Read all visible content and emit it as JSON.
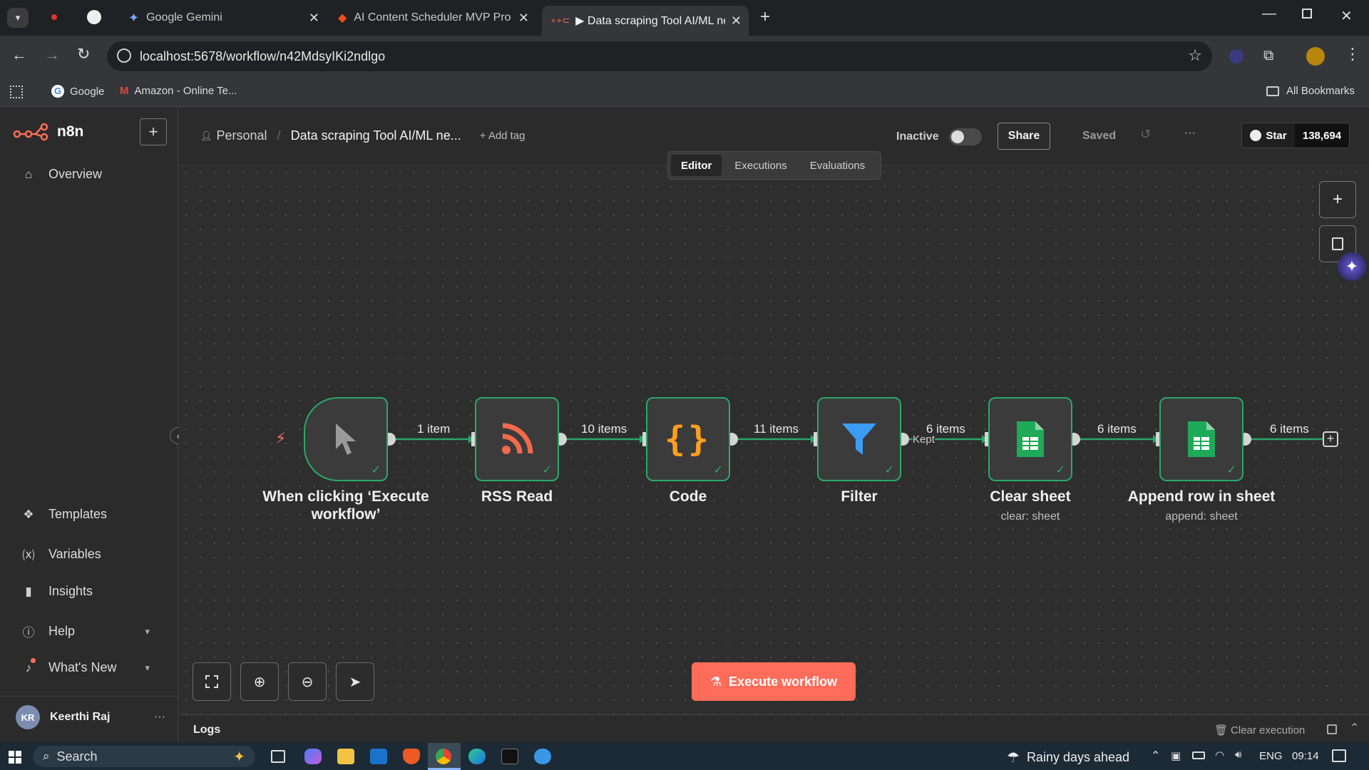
{
  "browser": {
    "tabs": [
      {
        "title": "Google Gemini"
      },
      {
        "title": "AI Content Scheduler MVP Prot"
      },
      {
        "title": "▶ Data scraping Tool AI/ML ne"
      }
    ],
    "url": "localhost:5678/workflow/n42MdsyIKi2ndlgo",
    "bookmarks": {
      "google": "Google",
      "amazon": "Amazon - Online Te...",
      "all": "All Bookmarks"
    }
  },
  "app": {
    "brand": "n8n",
    "sidebar": {
      "overview": "Overview",
      "bottom_items": [
        "Templates",
        "Variables",
        "Insights",
        "Help",
        "What's New"
      ],
      "user_initials": "KR",
      "user_name": "Keerthi Raj",
      "more": "···"
    },
    "header": {
      "project": "Personal",
      "workflow_name": "Data scraping Tool AI/ML ne...",
      "add_tag": "+ Add tag",
      "status_label": "Inactive",
      "share_label": "Share",
      "saved_label": "Saved",
      "more": "···",
      "github_star_label": "Star",
      "github_star_count": "138,694"
    },
    "view_tabs": [
      "Editor",
      "Executions",
      "Evaluations"
    ],
    "active_view_tab": "Editor"
  },
  "workflow": {
    "nodes": [
      {
        "label": "When clicking ‘Execute workflow’",
        "sub": ""
      },
      {
        "label": "RSS Read",
        "sub": ""
      },
      {
        "label": "Code",
        "sub": ""
      },
      {
        "label": "Filter",
        "sub": ""
      },
      {
        "label": "Clear sheet",
        "sub": "clear: sheet"
      },
      {
        "label": "Append row in sheet",
        "sub": "append: sheet"
      }
    ],
    "edges": [
      "1 item",
      "10 items",
      "11 items",
      "6 items",
      "6 items",
      "6 items"
    ],
    "filter_branch": "Kept",
    "execute_label": "Execute workflow",
    "icon_colors": {
      "rss": "#f26a4b",
      "code": "#ff9f1c",
      "filter": "#3b9cf6",
      "sheets": "#1faa59",
      "accent": "#ff6d5a",
      "success": "#2aa868"
    }
  },
  "logs": {
    "title": "Logs",
    "clear_label": "Clear execution"
  },
  "taskbar": {
    "search_placeholder": "Search",
    "weather": "Rainy days ahead",
    "lang": "ENG",
    "time": "09:14"
  }
}
